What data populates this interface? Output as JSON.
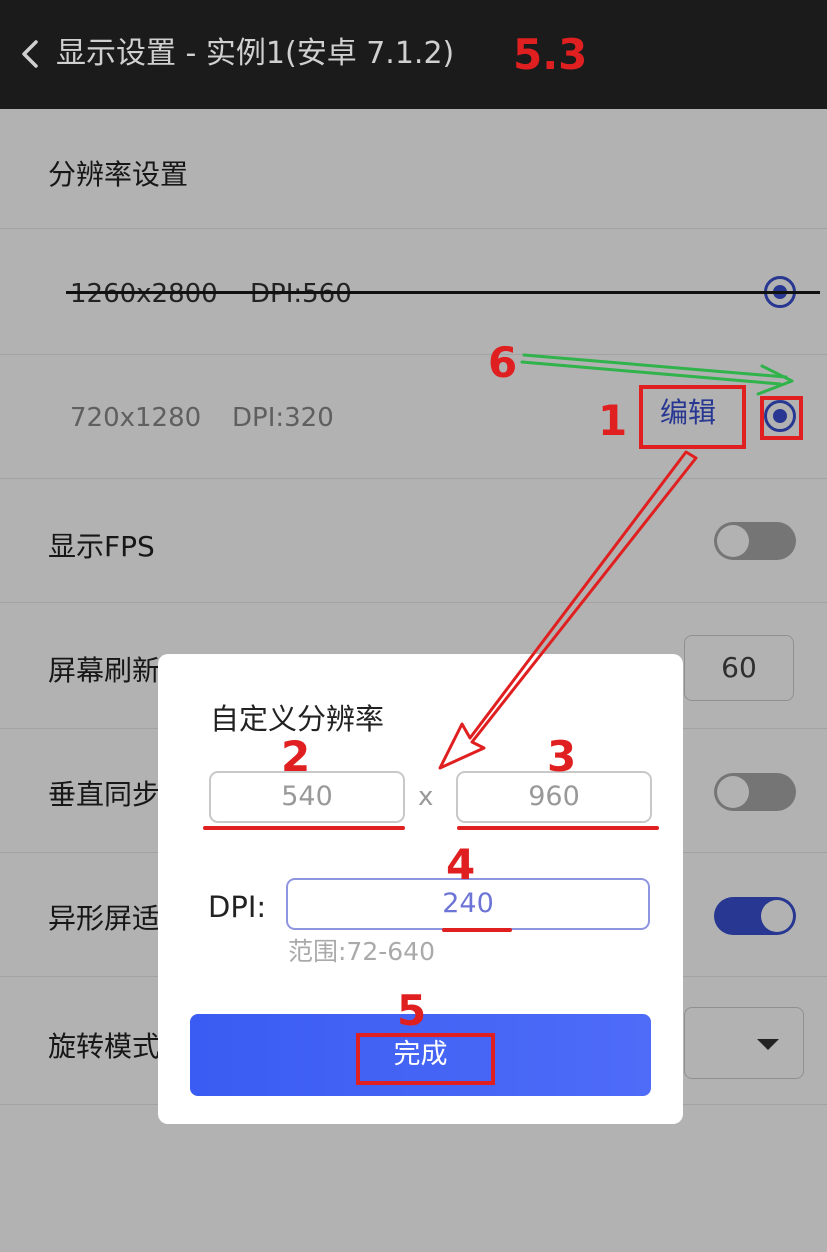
{
  "header": {
    "title": "显示设置 - 实例1(安卓 7.1.2)",
    "version_tag": "5.3",
    "icons": {
      "back": "chevron-left-icon"
    }
  },
  "settings": {
    "resolution_section": "分辨率设置",
    "resolution_options": [
      {
        "size": "1260x2800",
        "dpi": "DPI:560",
        "selected": true
      },
      {
        "size": "720x1280",
        "dpi": "DPI:320",
        "selected": true
      }
    ],
    "edit_label": "编辑",
    "show_fps_label": "显示FPS",
    "show_fps_on": false,
    "refresh_rate_label": "屏幕刷新",
    "refresh_rate_value": "60",
    "vsync_label": "垂直同步",
    "vsync_on": false,
    "notch_label": "异形屏适",
    "notch_on": true,
    "rotate_label": "旋转模式"
  },
  "dialog": {
    "title": "自定义分辨率",
    "width_placeholder": "540",
    "separator": "x",
    "height_placeholder": "960",
    "dpi_label": "DPI:",
    "dpi_value": "240",
    "dpi_range_hint": "范围:72-640",
    "done_label": "完成"
  },
  "annotations": {
    "step_1": "1",
    "step_2": "2",
    "step_3": "3",
    "step_4": "4",
    "step_5": "5",
    "step_6": "6",
    "colors": {
      "red": "#e02020",
      "green": "#2fb34a"
    }
  },
  "colors": {
    "accent": "#3a50d0",
    "title_bar_bg": "#1b1b1b",
    "done_button": "#3a5cf2"
  }
}
